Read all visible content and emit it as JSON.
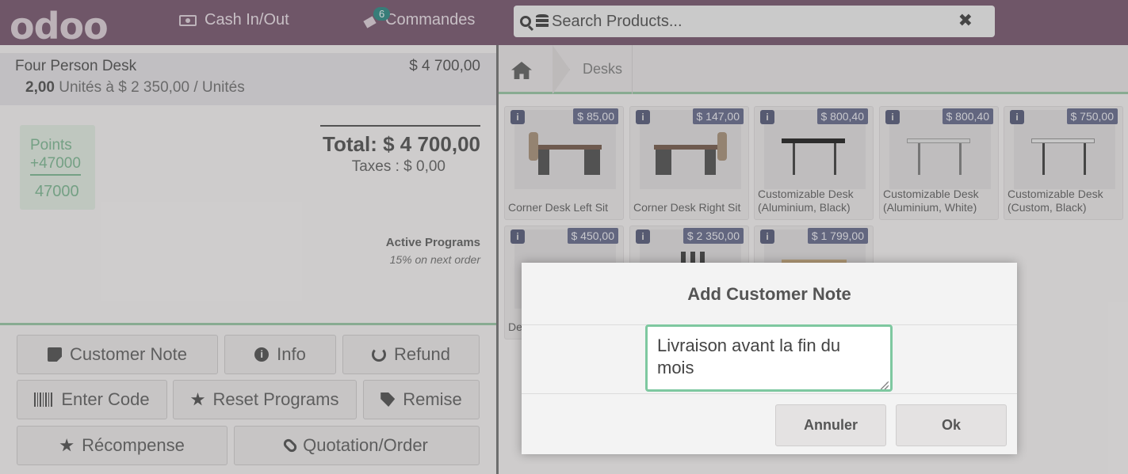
{
  "topbar": {
    "logo": "odoo",
    "cash_label": "Cash In/Out",
    "orders_label": "Commandes",
    "orders_count": "6",
    "search_placeholder": "Search Products...",
    "clear_symbol": "✖"
  },
  "order": {
    "line": {
      "name": "Four Person Desk",
      "price": "$ 4 700,00",
      "qty": "2,00",
      "unit_text": "Unités à $ 2 350,00 / Unités"
    },
    "points": {
      "label": "Points",
      "gain": "+47000",
      "total": "47000"
    },
    "total": "Total: $ 4 700,00",
    "taxes": "Taxes : $ 0,00",
    "active_programs_title": "Active Programs",
    "active_programs_desc": "15% on next order"
  },
  "controls": {
    "customer_note": "Customer Note",
    "info": "Info",
    "refund": "Refund",
    "enter_code": "Enter Code",
    "reset_programs": "Reset Programs",
    "remise": "Remise",
    "recompense": "Récompense",
    "quotation": "Quotation/Order"
  },
  "breadcrumb": {
    "category": "Desks"
  },
  "products": [
    {
      "name": "Corner Desk Left Sit",
      "price": "$ 85,00",
      "info": "i"
    },
    {
      "name": "Corner Desk Right Sit",
      "price": "$ 147,00",
      "info": "i"
    },
    {
      "name": "Customizable Desk (Aluminium, Black)",
      "price": "$ 800,40",
      "info": "i"
    },
    {
      "name": "Customizable Desk (Aluminium, White)",
      "price": "$ 800,40",
      "info": "i"
    },
    {
      "name": "Customizable Desk (Custom, Black)",
      "price": "$ 750,00",
      "info": "i"
    },
    {
      "name": "De",
      "price": "$ 450,00",
      "info": "i"
    },
    {
      "name": "",
      "price": "$ 2 350,00",
      "info": "i"
    },
    {
      "name": "",
      "price": "$ 1 799,00",
      "info": "i"
    }
  ],
  "modal": {
    "title": "Add Customer Note",
    "note_value": "Livraison avant la fin du mois",
    "cancel": "Annuler",
    "ok": "Ok"
  },
  "colors": {
    "topbar": "#6d4a63",
    "accent_green": "#7ec8a0",
    "price_badge": "#5a6083"
  }
}
